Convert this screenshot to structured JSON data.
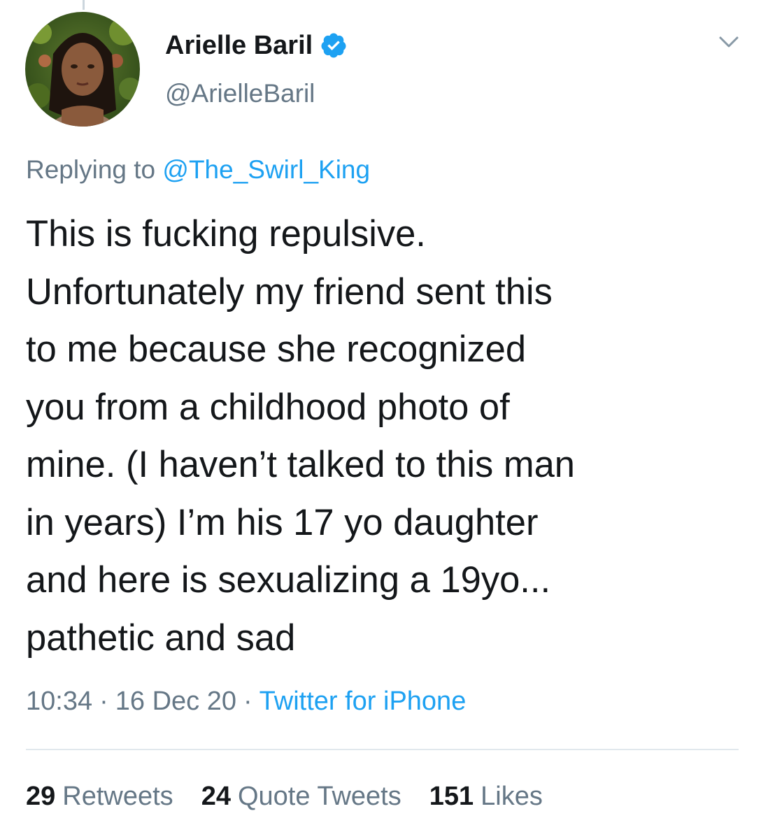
{
  "author": {
    "display_name": "Arielle Baril",
    "handle": "@ArielleBaril",
    "verified": true
  },
  "reply": {
    "prefix": "Replying to",
    "mention": "@The_Swirl_King"
  },
  "tweet": {
    "lines": [
      "This is fucking repulsive.",
      "Unfortunately my friend sent this",
      "to me because she recognized",
      "you from a childhood photo of",
      "mine. (I haven’t talked to this man",
      "in years) I’m his 17 yo daughter",
      "and here is sexualizing a 19yo...",
      "pathetic and sad"
    ]
  },
  "meta": {
    "time": "10:34",
    "date": "16 Dec 20",
    "separator": "·",
    "source": "Twitter for iPhone"
  },
  "stats": {
    "retweets_count": "29",
    "retweets_label": "Retweets",
    "quotes_count": "24",
    "quotes_label": "Quote Tweets",
    "likes_count": "151",
    "likes_label": "Likes"
  },
  "colors": {
    "accent": "#1da1f2",
    "secondary_text": "#657786",
    "primary_text": "#14171a",
    "divider": "#e1e8ed"
  },
  "icons": {
    "verified": "verified-badge-icon",
    "menu": "chevron-down-icon"
  }
}
